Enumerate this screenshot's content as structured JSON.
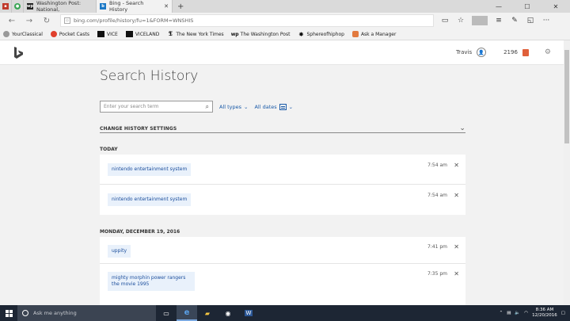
{
  "browser": {
    "tabs": [
      {
        "label": "Washington Post: National,",
        "active": false
      },
      {
        "label": "Bing - Search History",
        "active": true
      }
    ],
    "url": "bing.com/profile/history/fu=1&FORM=WNSHIS",
    "favorites": [
      "YourClassical",
      "Pocket Casts",
      "VICE",
      "VICELAND",
      "The New York Times",
      "The Washington Post",
      "Sphereofhiphop",
      "Ask a Manager"
    ]
  },
  "header": {
    "user_name": "Travis",
    "rewards_points": "2196"
  },
  "page": {
    "title": "Search History",
    "search_placeholder": "Enter your search term",
    "filter_types": "All types",
    "filter_dates": "All dates",
    "settings_label": "CHANGE HISTORY SETTINGS"
  },
  "history": [
    {
      "label": "TODAY",
      "entries": [
        {
          "query": "nintendo entertainment system",
          "time": "7:54 am"
        },
        {
          "query": "nintendo entertainment system",
          "time": "7:54 am"
        }
      ]
    },
    {
      "label": "MONDAY, DECEMBER 19, 2016",
      "entries": [
        {
          "query": "uppity",
          "time": "7:41 pm"
        },
        {
          "query": "mighty morphin power rangers the movie 1995",
          "time": "7:35 pm"
        }
      ]
    }
  ],
  "taskbar": {
    "cortana_text": "Ask me anything",
    "time": "8:36 AM",
    "date": "12/20/2016"
  }
}
